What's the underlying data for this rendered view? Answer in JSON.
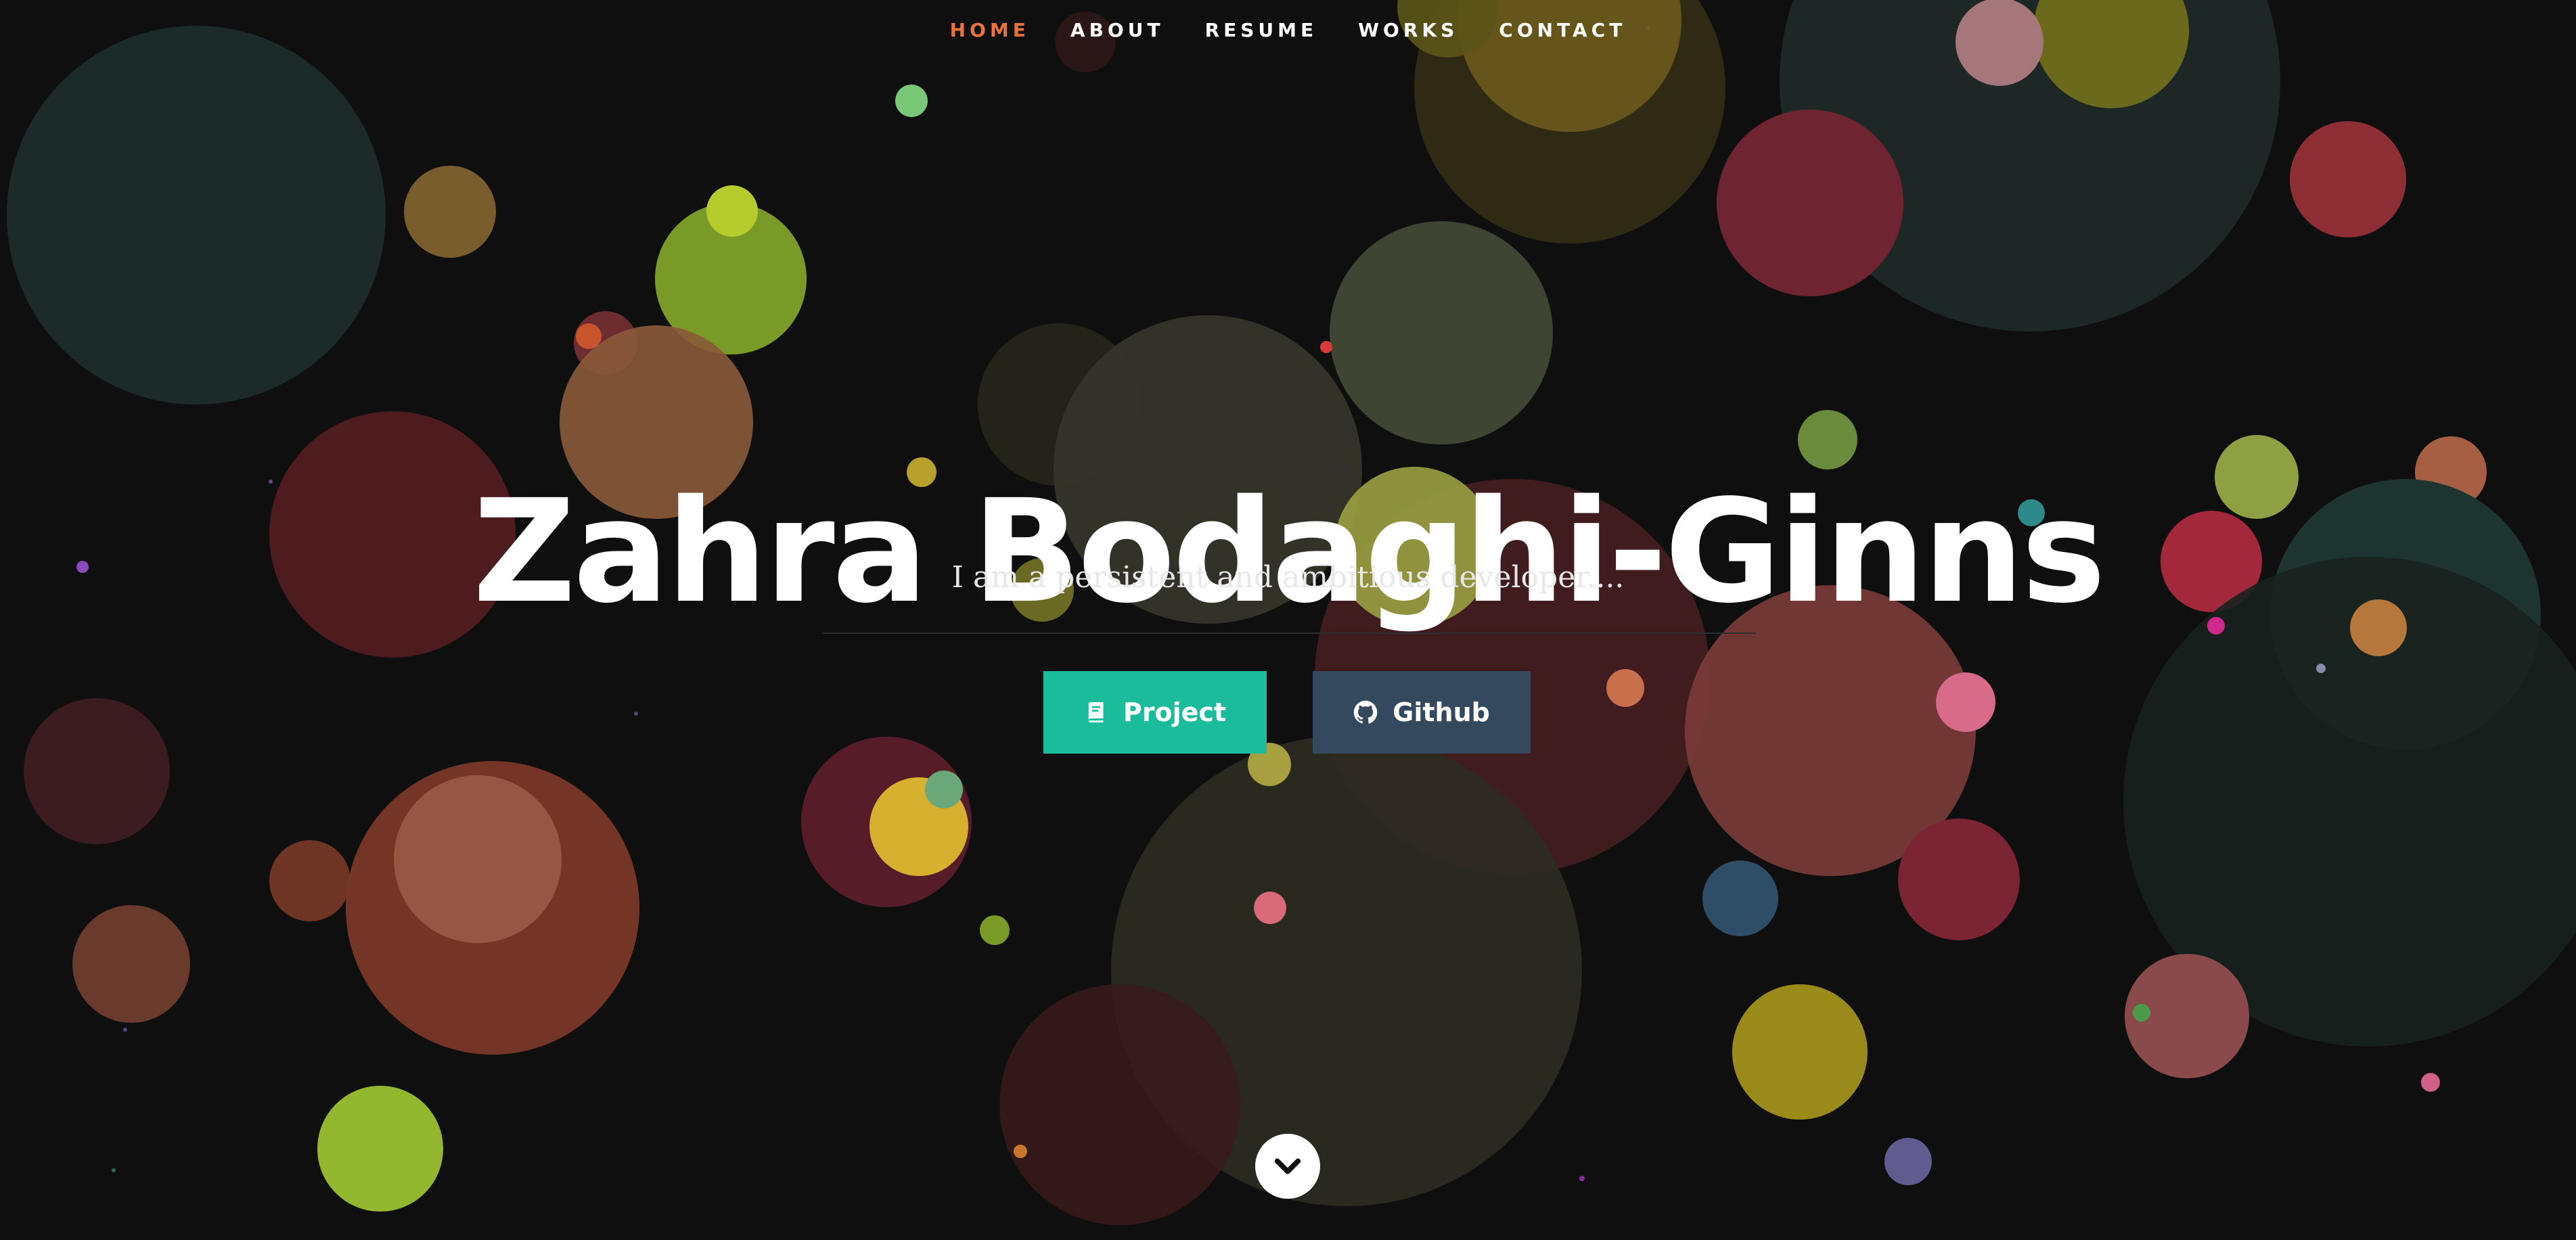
{
  "nav": {
    "items": [
      {
        "label": "HOME",
        "active": true
      },
      {
        "label": "ABOUT",
        "active": false
      },
      {
        "label": "RESUME",
        "active": false
      },
      {
        "label": "WORKS",
        "active": false
      },
      {
        "label": "CONTACT",
        "active": false
      }
    ]
  },
  "hero": {
    "title": "Zahra Bodaghi-Ginns",
    "tagline": "I am a persistent and ambitious developer....",
    "buttons": {
      "project_label": "Project",
      "project_icon": "book-icon",
      "github_label": "Github",
      "github_icon": "github-icon"
    },
    "scroll_icon": "chevron-down-icon"
  },
  "colors": {
    "background": "#0f0f0f",
    "nav_active": "#e8743b",
    "project_button": "#1abc9c",
    "github_button": "#34495e"
  }
}
